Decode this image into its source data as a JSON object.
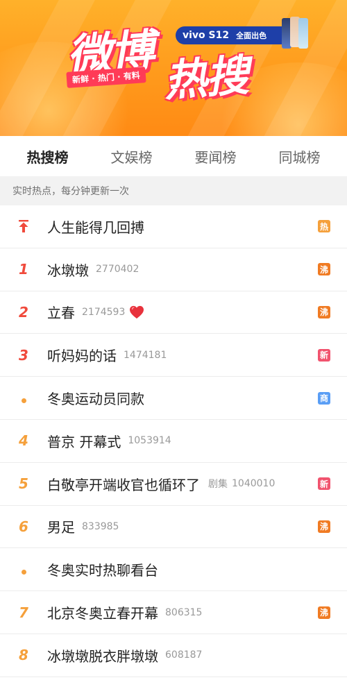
{
  "banner": {
    "logo_part1": "微博",
    "logo_part2": "热搜",
    "tagline": "新鲜 · 热门 · 有料",
    "ad_model": "vivo S12",
    "ad_slogan": "全面出色"
  },
  "tabs": [
    {
      "label": "热搜榜",
      "active": true
    },
    {
      "label": "文娱榜",
      "active": false
    },
    {
      "label": "要闻榜",
      "active": false
    },
    {
      "label": "同城榜",
      "active": false
    }
  ],
  "subtitle": "实时热点，每分钟更新一次",
  "colors": {
    "rank_top": "#f04a3c",
    "rank_other": "#f5a03b",
    "badge_hot": "#f5a03b",
    "badge_boil": "#f07b23",
    "badge_new": "#f1536e",
    "badge_ad": "#5a9ef5"
  },
  "items": [
    {
      "rank": "",
      "rank_icon": "pin-top-icon",
      "title": "人生能得几回搏",
      "label": "",
      "count": "",
      "badge": "热",
      "badge_type": "hot"
    },
    {
      "rank": "1",
      "title": "冰墩墩",
      "label": "",
      "count": "2770402",
      "badge": "沸",
      "badge_type": "boil"
    },
    {
      "rank": "2",
      "title": "立春",
      "label": "",
      "count": "2174593",
      "extra_icon": "heart-icon",
      "badge": "沸",
      "badge_type": "boil"
    },
    {
      "rank": "3",
      "title": "听妈妈的话",
      "label": "",
      "count": "1474181",
      "badge": "新",
      "badge_type": "new"
    },
    {
      "rank": "",
      "rank_icon": "dot-icon",
      "title": "冬奥运动员同款",
      "label": "",
      "count": "",
      "badge": "商",
      "badge_type": "ad"
    },
    {
      "rank": "4",
      "title": "普京 开幕式",
      "label": "",
      "count": "1053914",
      "badge": "",
      "badge_type": ""
    },
    {
      "rank": "5",
      "title": "白敬亭开端收官也循环了",
      "label": "剧集",
      "count": "1040010",
      "badge": "新",
      "badge_type": "new"
    },
    {
      "rank": "6",
      "title": "男足",
      "label": "",
      "count": "833985",
      "badge": "沸",
      "badge_type": "boil"
    },
    {
      "rank": "",
      "rank_icon": "dot-icon",
      "title": "冬奥实时热聊看台",
      "label": "",
      "count": "",
      "badge": "",
      "badge_type": ""
    },
    {
      "rank": "7",
      "title": "北京冬奥立春开幕",
      "label": "",
      "count": "806315",
      "badge": "沸",
      "badge_type": "boil"
    },
    {
      "rank": "8",
      "title": "冰墩墩脱衣胖墩墩",
      "label": "",
      "count": "608187",
      "badge": "",
      "badge_type": ""
    }
  ]
}
